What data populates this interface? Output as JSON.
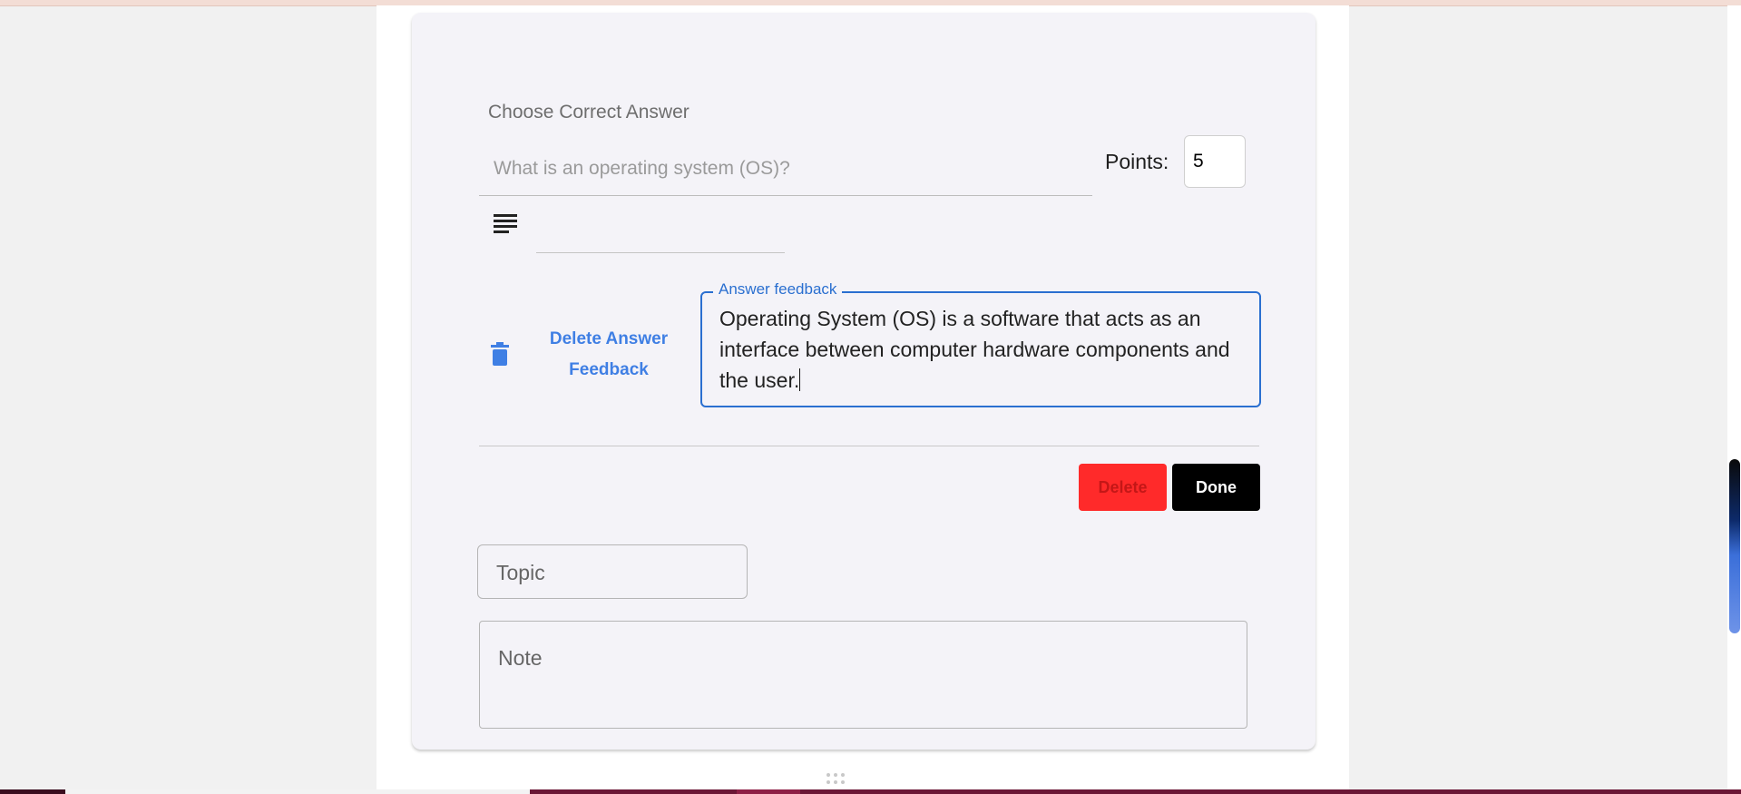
{
  "question": {
    "type_label": "Choose Correct Answer",
    "text_placeholder": "What is an operating system (OS)?",
    "points_label": "Points:",
    "points_value": "5"
  },
  "feedback": {
    "delete_link_label": "Delete Answer Feedback",
    "legend": "Answer feedback",
    "text": "Operating System (OS) is a software that acts as an interface between computer hardware components and the user."
  },
  "actions": {
    "delete_label": "Delete",
    "done_label": "Done"
  },
  "fields": {
    "topic_placeholder": "Topic",
    "note_placeholder": "Note"
  },
  "colors": {
    "accent_blue": "#2a6fd0",
    "link_blue": "#3f7fe4",
    "delete_red": "#ff2a2a",
    "done_black": "#000000"
  },
  "icons": {
    "format": "text-format-icon",
    "trash": "trash-icon",
    "drag": "drag-handle-icon"
  }
}
